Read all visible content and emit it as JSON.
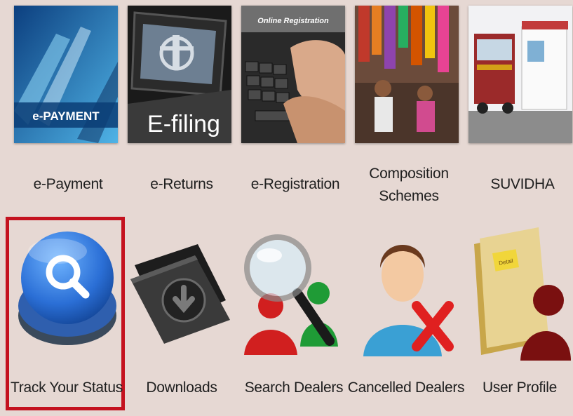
{
  "tiles_row1": [
    {
      "label": "e-Payment",
      "image_text": "e-PAYMENT"
    },
    {
      "label": "e-Returns",
      "image_text": "E-filing"
    },
    {
      "label": "e-Registration",
      "image_text": "Online Registration"
    },
    {
      "label_line1": "Composition",
      "label_line2": "Schemes"
    },
    {
      "label": "SUVIDHA"
    }
  ],
  "tiles_row2": [
    {
      "label": "Track Your Status",
      "selected": true
    },
    {
      "label": "Downloads"
    },
    {
      "label": "Search Dealers"
    },
    {
      "label": "Cancelled Dealers"
    },
    {
      "label": "User Profile",
      "folder_text": "Detail"
    }
  ],
  "colors": {
    "background": "#e6d8d3",
    "highlight_border": "#c4121f",
    "track_blue": "#2b6fd6"
  }
}
